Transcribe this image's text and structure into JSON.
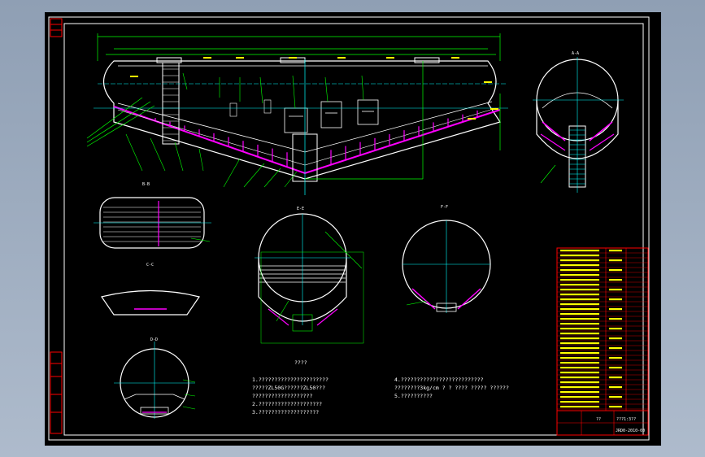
{
  "colors": {
    "background": "#000000",
    "frame": "#ffffff",
    "outline": "#ffffff",
    "dimension": "#00ff00",
    "axis": "#00ffff",
    "section": "#ff00ff",
    "annotation": "#ffff00",
    "hatch": "#ff0000",
    "title_block": "#ff0000"
  },
  "views": {
    "side_label": "A-A",
    "section_b": "B-B",
    "section_c": "C-C",
    "section_d": "D-D",
    "section_e": "E-E",
    "section_f": "F-F"
  },
  "notes": {
    "heading": "????",
    "lines": [
      "1.??????????????????????",
      "  ?????ZL50G??????ZL50???",
      "  ???????????????????",
      "2.????????????????????",
      "3.???????????????????"
    ],
    "lines_right": [
      "4.??????????????????????????",
      "  ????????3kg/cm  ? ?   ????  ?????   ??????",
      "5.??????????"
    ]
  },
  "title_block": {
    "material_label": "??",
    "scale_label": "???1:3??",
    "drawing_number": "JRD0-2010-00"
  }
}
